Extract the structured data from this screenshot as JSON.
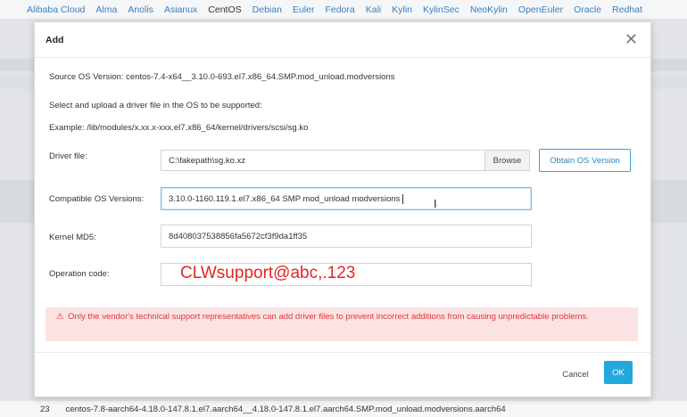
{
  "os_tabs": [
    "Alibaba Cloud",
    "Alma",
    "Anolis",
    "Asianux",
    "CentOS",
    "Debian",
    "Euler",
    "Fedora",
    "Kali",
    "Kylin",
    "KylinSec",
    "NeoKylin",
    "OpenEuler",
    "Oracle",
    "Redhat"
  ],
  "active_tab": "CentOS",
  "background_row": {
    "index": "23",
    "text": "centos-7.8-aarch64-4.18.0-147.8.1.el7.aarch64__4.18.0-147.8.1.el7.aarch64.SMP.mod_unload.modversions.aarch64"
  },
  "modal": {
    "title": "Add",
    "close_symbol": "✕",
    "source_os_version": "Source OS Version: centos-7.4-x64__3.10.0-693.el7.x86_64.SMP.mod_unload.modversions",
    "instruction": "Select and upload a driver file in the OS to be supported:",
    "example": "Example: /lib/modules/x.xx.x-xxx.el7.x86_64/kernel/drivers/scsi/sg.ko",
    "driver_file": {
      "label": "Driver file:",
      "value": "C:\\fakepath\\sg.ko.xz",
      "browse_label": "Browse",
      "obtain_label": "Obtain OS Version"
    },
    "compatible_os": {
      "label": "Compatible OS Versions:",
      "value": "3.10.0-1160.119.1.el7.x86_64 SMP mod_unload modversions"
    },
    "kernel_md5": {
      "label": "Kernel MD5:",
      "value": "8d408037538856fa5672cf3f9da1ff35"
    },
    "operation_code": {
      "label": "Operation code:",
      "value": "CLWsupport@abc,.123"
    },
    "warning": {
      "icon": "warning-triangle-icon",
      "symbol": "⚠",
      "text": "Only the vendor's technical support representatives can add driver files to prevent incorrect additions from causing unpredictable problems."
    },
    "cancel_label": "Cancel",
    "ok_label": "OK"
  },
  "colors": {
    "link": "#3a7fc1",
    "primary": "#22a8dd",
    "warning_bg": "#fbe3e3",
    "warning_text": "#d9383a",
    "annotation": "#e3261f"
  }
}
